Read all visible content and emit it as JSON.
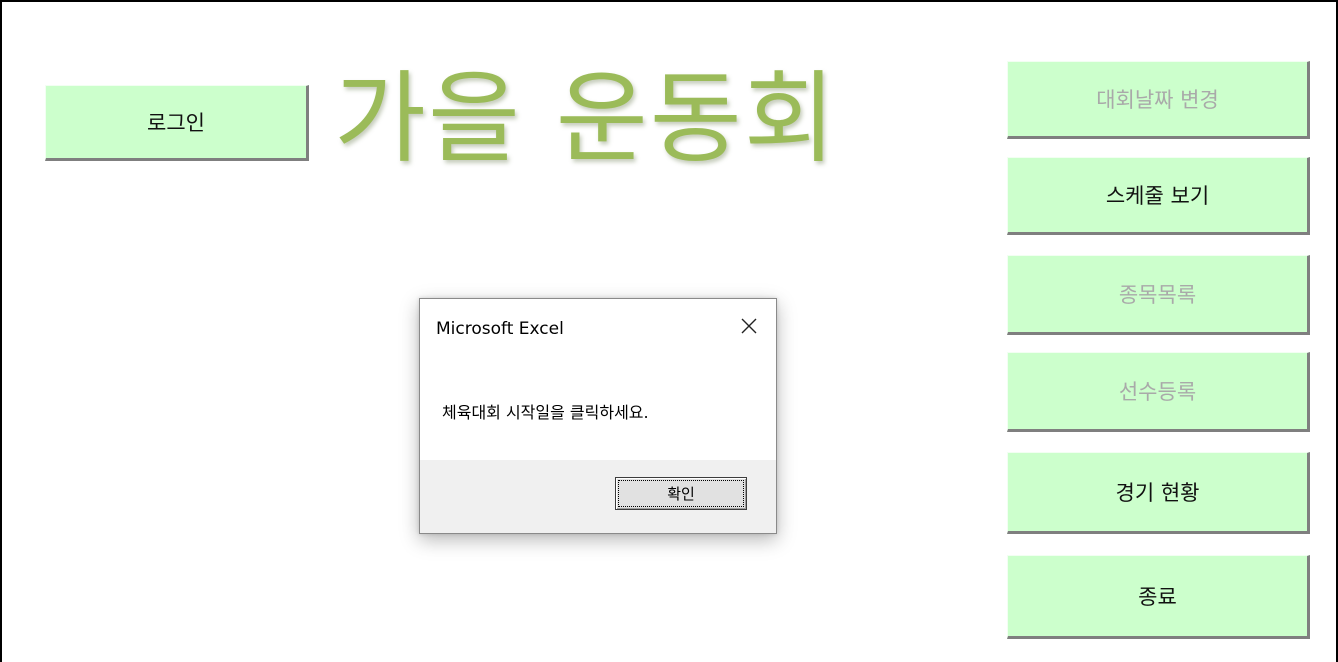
{
  "sheet": {
    "title": "가을 운동회",
    "login_label": "로그인"
  },
  "side_buttons": {
    "change_date": "대회날짜 변경",
    "view_schedule": "스케줄 보기",
    "event_list": "종목목록",
    "player_register": "선수등록",
    "match_status": "경기 현황",
    "exit": "종료"
  },
  "dialog": {
    "title": "Microsoft Excel",
    "message": "체육대회 시작일을 클릭하세요.",
    "ok_label": "확인",
    "close_icon": "close-icon"
  },
  "colors": {
    "button_bg": "#ccffcc",
    "title_color": "#9bbb59",
    "disabled_text": "#a9a9a9"
  }
}
